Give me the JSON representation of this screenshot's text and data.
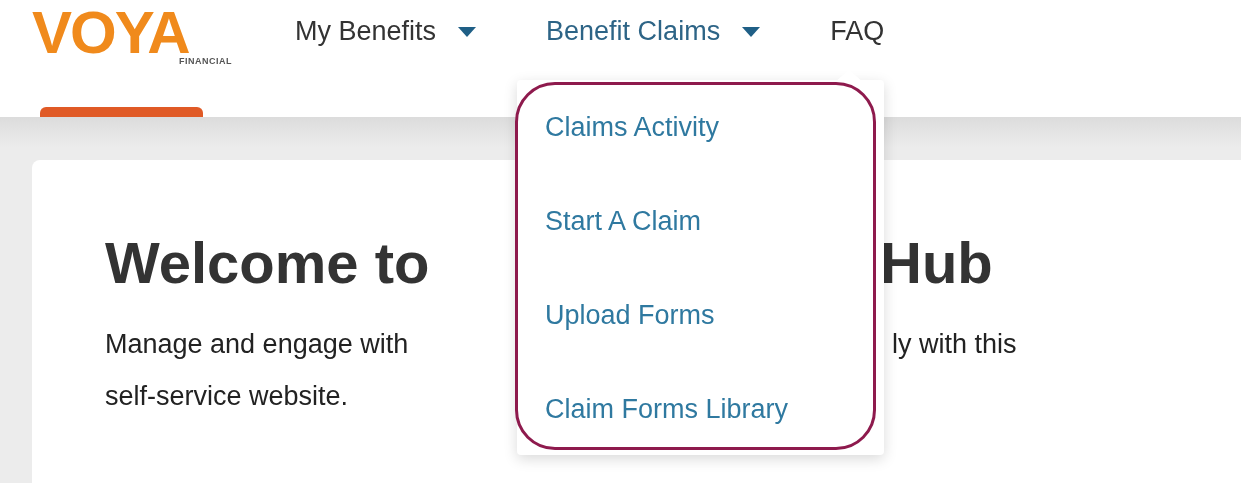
{
  "logo": {
    "wordmark": "VOYA",
    "subtitle": "FINANCIAL"
  },
  "nav": [
    {
      "label": "My Benefits",
      "has_menu": true,
      "selected": false
    },
    {
      "label": "Benefit Claims",
      "has_menu": true,
      "selected": true
    },
    {
      "label": "FAQ",
      "has_menu": false,
      "selected": false
    }
  ],
  "dropdown": {
    "highlighted": true,
    "items": [
      "Claims Activity",
      "Start A Claim",
      "Upload Forms",
      "Claim Forms Library"
    ]
  },
  "welcome": {
    "heading_left": "Welcome to",
    "heading_right": "Hub",
    "intro_left": "Manage and engage with",
    "intro_right": "ly with this",
    "intro_line2": "self-service website."
  }
}
